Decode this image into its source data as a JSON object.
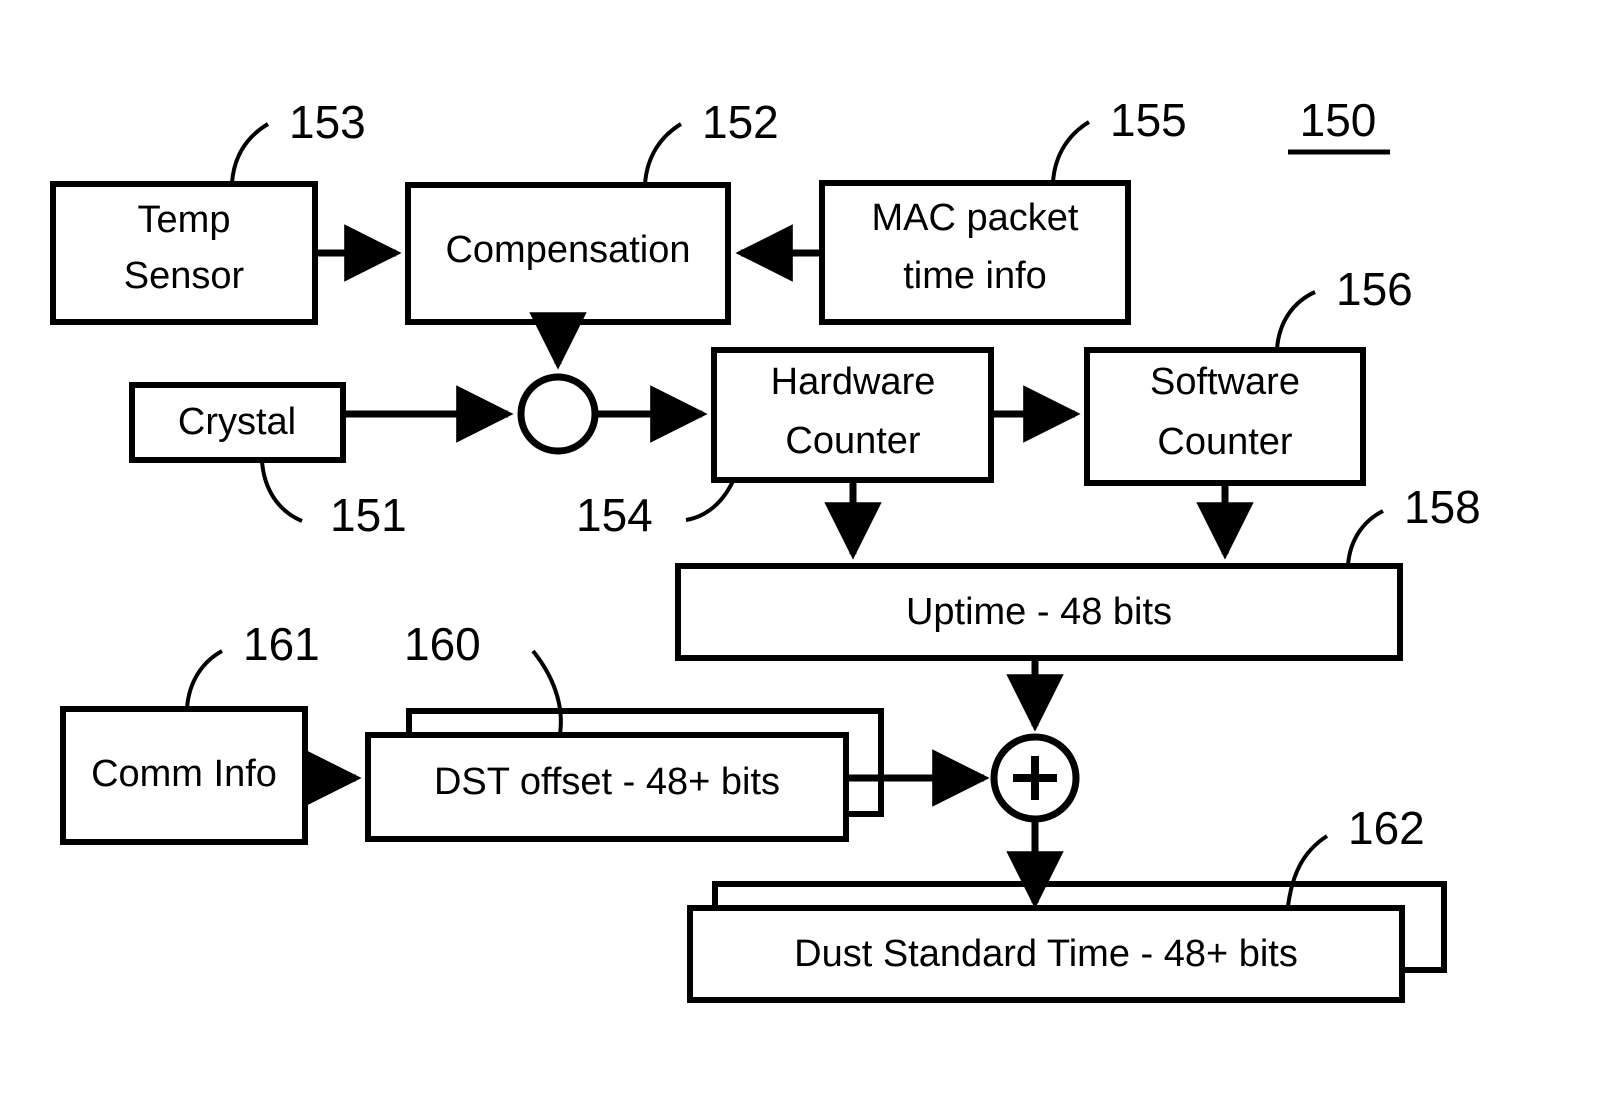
{
  "figure": {
    "number": "150",
    "underlined": true
  },
  "blocks": {
    "temp_sensor": {
      "line1": "Temp",
      "line2": "Sensor",
      "ref": "153"
    },
    "compensation": {
      "line1": "Compensation",
      "ref": "152"
    },
    "mac_packet": {
      "line1": "MAC packet",
      "line2": "time info",
      "ref": "155"
    },
    "crystal": {
      "line1": "Crystal",
      "ref": "151"
    },
    "summing_node": {
      "label": "",
      "ref": "154"
    },
    "hardware_counter": {
      "line1": "Hardware",
      "line2": "Counter",
      "ref": ""
    },
    "software_counter": {
      "line1": "Software",
      "line2": "Counter",
      "ref": "156"
    },
    "uptime": {
      "line1": "Uptime - 48 bits",
      "ref": "158"
    },
    "comm_info": {
      "line1": "Comm Info",
      "ref": "161"
    },
    "dst_offset": {
      "line1": "DST offset - 48+ bits",
      "ref": "160"
    },
    "adder": {
      "label": "+",
      "ref": ""
    },
    "dust_standard_time": {
      "line1": "Dust Standard Time - 48+ bits",
      "ref": "162"
    }
  },
  "colors": {
    "stroke": "#000000",
    "fill": "#ffffff",
    "background": "#ffffff"
  }
}
